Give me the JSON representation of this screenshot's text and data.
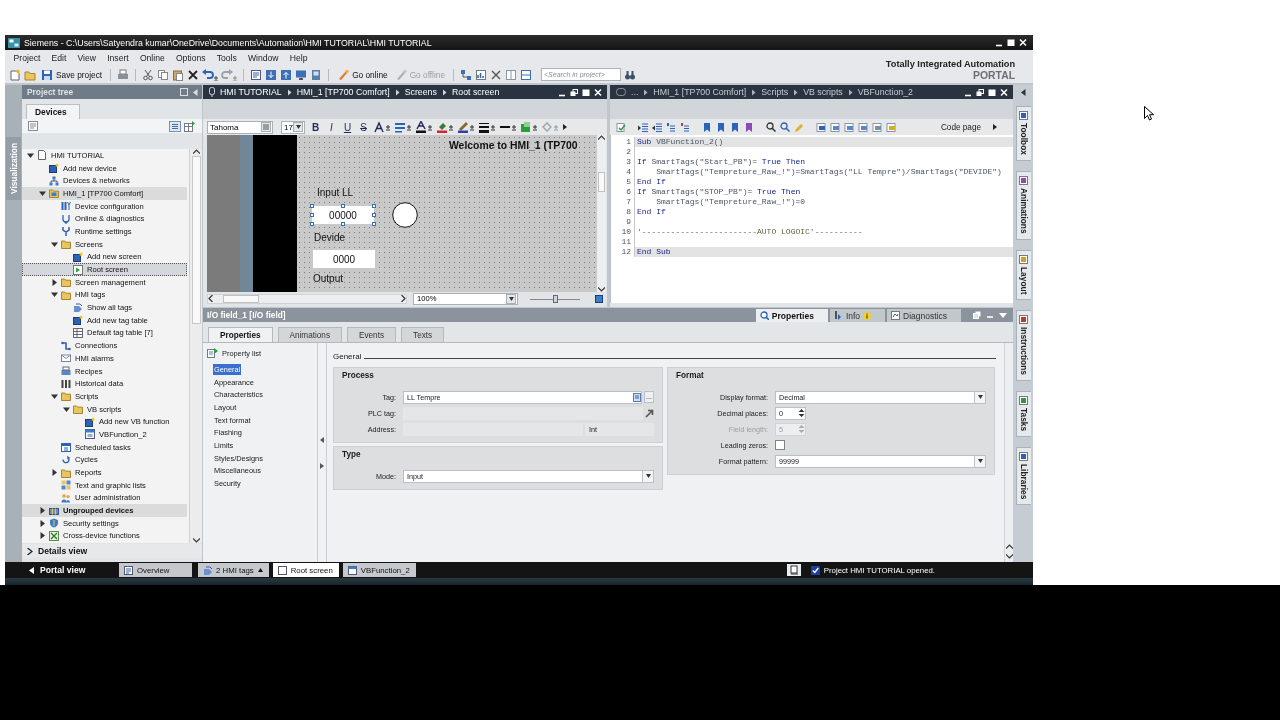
{
  "window": {
    "title": "Siemens - C:\\Users\\Satyendra kumar\\OneDrive\\Documents\\Automation\\HMI TUTORIAL\\HMI TUTORIAL"
  },
  "menu": [
    "Project",
    "Edit",
    "View",
    "Insert",
    "Online",
    "Options",
    "Tools",
    "Window",
    "Help"
  ],
  "branding": {
    "line_1": "Totally Integrated Automation",
    "line_2": "PORTAL"
  },
  "toolbar": {
    "buttons": [
      {
        "label": "Save project",
        "disabled": false
      },
      {
        "label": "Go online",
        "disabled": false
      },
      {
        "label": "Go offline",
        "disabled": true
      }
    ],
    "search": {
      "placeholder": "<Search in project>"
    }
  },
  "left_tabs": [
    "Visualization"
  ],
  "project_tree": {
    "title": "Project tree",
    "tab": "Devices",
    "items": [
      {
        "label": "HMI TUTORIAL",
        "kind": "project",
        "expanded": true,
        "selected": false,
        "children": [
          {
            "label": "Add new device",
            "kind": "add",
            "selected": false
          },
          {
            "label": "Devices & networks",
            "kind": "network",
            "selected": false
          },
          {
            "label": "HMI_1 [TP700 Comfort]",
            "kind": "device",
            "expanded": true,
            "selected": false,
            "children": [
              {
                "label": "Device configuration",
                "kind": "config",
                "selected": false
              },
              {
                "label": "Online & diagnostics",
                "kind": "diagnostics",
                "selected": false
              },
              {
                "label": "Runtime settings",
                "kind": "settings",
                "selected": false
              },
              {
                "label": "Screens",
                "kind": "folder",
                "expanded": true,
                "selected": false,
                "children": [
                  {
                    "label": "Add new screen",
                    "kind": "add",
                    "selected": false
                  },
                  {
                    "label": "Root screen",
                    "kind": "screen",
                    "selected": true
                  }
                ]
              },
              {
                "label": "Screen management",
                "kind": "folder",
                "expanded": false,
                "selected": false
              },
              {
                "label": "HMI tags",
                "kind": "folder",
                "expanded": true,
                "selected": false,
                "children": [
                  {
                    "label": "Show all tags",
                    "kind": "tags",
                    "selected": false
                  },
                  {
                    "label": "Add new tag table",
                    "kind": "add",
                    "selected": false
                  },
                  {
                    "label": "Default tag table [7]",
                    "kind": "table",
                    "selected": false
                  }
                ]
              },
              {
                "label": "Connections",
                "kind": "connections",
                "selected": false
              },
              {
                "label": "HMI alarms",
                "kind": "alarms",
                "selected": false
              },
              {
                "label": "Recipes",
                "kind": "recipes",
                "selected": false
              },
              {
                "label": "Historical data",
                "kind": "data",
                "selected": false
              },
              {
                "label": "Scripts",
                "kind": "folder",
                "expanded": true,
                "selected": false,
                "children": [
                  {
                    "label": "VB scripts",
                    "kind": "folder",
                    "expanded": true,
                    "selected": false,
                    "children": [
                      {
                        "label": "Add new VB function",
                        "kind": "add",
                        "selected": false
                      },
                      {
                        "label": "VBFunction_2",
                        "kind": "script",
                        "selected": false
                      }
                    ]
                  }
                ]
              },
              {
                "label": "Scheduled tasks",
                "kind": "tasks",
                "selected": false
              },
              {
                "label": "Cycles",
                "kind": "cycles",
                "selected": false
              },
              {
                "label": "Reports",
                "kind": "folder",
                "expanded": false,
                "selected": false
              },
              {
                "label": "Text and graphic lists",
                "kind": "lists",
                "selected": false
              },
              {
                "label": "User administration",
                "kind": "users",
                "selected": false
              }
            ]
          },
          {
            "label": "Ungrouped devices",
            "kind": "group",
            "expanded": false,
            "selected": false
          },
          {
            "label": "Security settings",
            "kind": "security",
            "expanded": false,
            "selected": false
          },
          {
            "label": "Cross-device functions",
            "kind": "crossdevice",
            "expanded": false,
            "selected": false
          }
        ]
      }
    ]
  },
  "details_view": {
    "label": "Details view",
    "expanded": false
  },
  "screen_editor": {
    "breadcrumb": [
      "HMI TUTORIAL",
      "HMI_1 [TP700 Comfort]",
      "Screens",
      "Root screen"
    ],
    "font": "Tahoma",
    "font_size": "17",
    "style_buttons": [
      {
        "label": "B",
        "kind": "bold"
      },
      {
        "label": "I",
        "kind": "italic"
      },
      {
        "label": "U",
        "kind": "underline"
      },
      {
        "label": "S",
        "kind": "strike"
      }
    ],
    "canvas": {
      "title": "Welcome to HMI_1 (TP700",
      "objects": [
        {
          "kind": "label",
          "text": "Input LL"
        },
        {
          "kind": "io_field",
          "text": "00000",
          "selected": true
        },
        {
          "kind": "circle"
        },
        {
          "kind": "label",
          "text": "Devide"
        },
        {
          "kind": "io_field",
          "text": "0000",
          "selected": false
        },
        {
          "kind": "label",
          "text": "Output"
        }
      ]
    },
    "zoom": "100%",
    "zoom_slider": {
      "level": 0.5
    }
  },
  "script_editor": {
    "breadcrumb": [
      "...",
      "HMI_1 [TP700 Comfort]",
      "Scripts",
      "VB scripts",
      "VBFunction_2"
    ],
    "code_page": "Code page",
    "lines": [
      {
        "number": "1",
        "highlighted": true,
        "tokens": [
          {
            "text": "Sub",
            "kind": "keyword"
          },
          {
            "text": " VBFunction_2()",
            "kind": "plain"
          }
        ]
      },
      {
        "number": "2",
        "highlighted": false
      },
      {
        "number": "3",
        "highlighted": false,
        "tokens": [
          {
            "text": "If",
            "kind": "keyword"
          },
          {
            "text": " SmartTags(\"Start_PB\")= ",
            "kind": "plain"
          },
          {
            "text": "True Then",
            "kind": "keyword"
          }
        ]
      },
      {
        "number": "4",
        "highlighted": false,
        "tokens": [
          {
            "text": "    SmartTags(\"Tempreture_Raw_!\")=SmartTags(\"LL Tempre\")/SmartTags(\"DEVIDE\")",
            "kind": "plain"
          }
        ]
      },
      {
        "number": "5",
        "highlighted": false,
        "tokens": [
          {
            "text": "End If",
            "kind": "keyword"
          }
        ]
      },
      {
        "number": "6",
        "highlighted": false,
        "tokens": [
          {
            "text": "If",
            "kind": "keyword"
          },
          {
            "text": " SmartTags(\"STOP_PB\")= ",
            "kind": "plain"
          },
          {
            "text": "True Then",
            "kind": "keyword"
          }
        ]
      },
      {
        "number": "7",
        "highlighted": false,
        "tokens": [
          {
            "text": "    SmartTags(\"Tempreture_Raw_!\")=0",
            "kind": "plain"
          }
        ]
      },
      {
        "number": "8",
        "highlighted": false,
        "tokens": [
          {
            "text": "End If",
            "kind": "keyword"
          }
        ]
      },
      {
        "number": "9",
        "highlighted": false
      },
      {
        "number": "10",
        "highlighted": false,
        "tokens": [
          {
            "text": "'------------------------AUTO LOGOIC'----------",
            "kind": "comment"
          }
        ]
      },
      {
        "number": "11",
        "highlighted": false
      },
      {
        "number": "12",
        "highlighted": true,
        "tokens": [
          {
            "text": "End Sub",
            "kind": "keyword"
          }
        ]
      }
    ]
  },
  "inspector": {
    "title": "I/O field_1 [I/O field]",
    "views": [
      {
        "label": "Properties",
        "kind": "properties",
        "selected": true
      },
      {
        "label": "Info",
        "kind": "info",
        "selected": false
      },
      {
        "label": "Diagnostics",
        "kind": "diagnostics",
        "selected": false
      }
    ],
    "tabs": [
      {
        "label": "Properties",
        "selected": true
      },
      {
        "label": "Animations",
        "selected": false
      },
      {
        "label": "Events",
        "selected": false
      },
      {
        "label": "Texts",
        "selected": false
      }
    ],
    "property_list": {
      "title": "Property list",
      "items": [
        {
          "label": "General",
          "selected": true
        },
        {
          "label": "Appearance",
          "selected": false
        },
        {
          "label": "Characteristics",
          "selected": false
        },
        {
          "label": "Layout",
          "selected": false
        },
        {
          "label": "Text format",
          "selected": false
        },
        {
          "label": "Flashing",
          "selected": false
        },
        {
          "label": "Limits",
          "selected": false
        },
        {
          "label": "Styles/Designs",
          "selected": false
        },
        {
          "label": "Miscellaneous",
          "selected": false
        },
        {
          "label": "Security",
          "selected": false
        }
      ]
    },
    "section": "General",
    "columns": [
      {
        "groups": [
          {
            "title": "Process",
            "fields": [
              {
                "label": "Tag:",
                "kind": "picker",
                "value": "LL Tempre",
                "button": "...",
                "disabled": false
              },
              {
                "label": "PLC tag:",
                "kind": "link",
                "disabled": false
              },
              {
                "label": "Address:",
                "kind": "address",
                "unit": "Int",
                "disabled": false
              }
            ]
          },
          {
            "title": "Type",
            "fields": [
              {
                "label": "Mode:",
                "kind": "dropdown",
                "value": "Input",
                "disabled": false
              }
            ]
          }
        ]
      },
      {
        "groups": [
          {
            "title": "Format",
            "fields": [
              {
                "label": "Display format:",
                "kind": "dropdown",
                "value": "Decimal",
                "disabled": false
              },
              {
                "label": "Decimal places:",
                "kind": "spinner",
                "value": "0",
                "disabled": false
              },
              {
                "label": "Field length:",
                "kind": "spinner",
                "value": "5",
                "disabled": true
              },
              {
                "label": "Leading zeros:",
                "kind": "checkbox",
                "checked": false,
                "disabled": false
              },
              {
                "label": "Format pattern:",
                "kind": "dropdown",
                "value": "99999",
                "disabled": false
              }
            ]
          }
        ]
      }
    ]
  },
  "right_tabs": [
    "Toolbox",
    "Animations",
    "Layout",
    "Instructions",
    "Tasks",
    "Libraries"
  ],
  "taskbar": {
    "portal_view": "Portal view",
    "items": [
      {
        "label": "Overview",
        "kind": "overview",
        "selected": false
      },
      {
        "label": "2 HMI tags",
        "kind": "tags",
        "selected": false
      },
      {
        "label": "Root screen",
        "kind": "screen",
        "selected": true
      },
      {
        "label": "VBFunction_2",
        "kind": "script",
        "selected": false
      }
    ],
    "status": "Project HMI TUTORIAL opened."
  }
}
